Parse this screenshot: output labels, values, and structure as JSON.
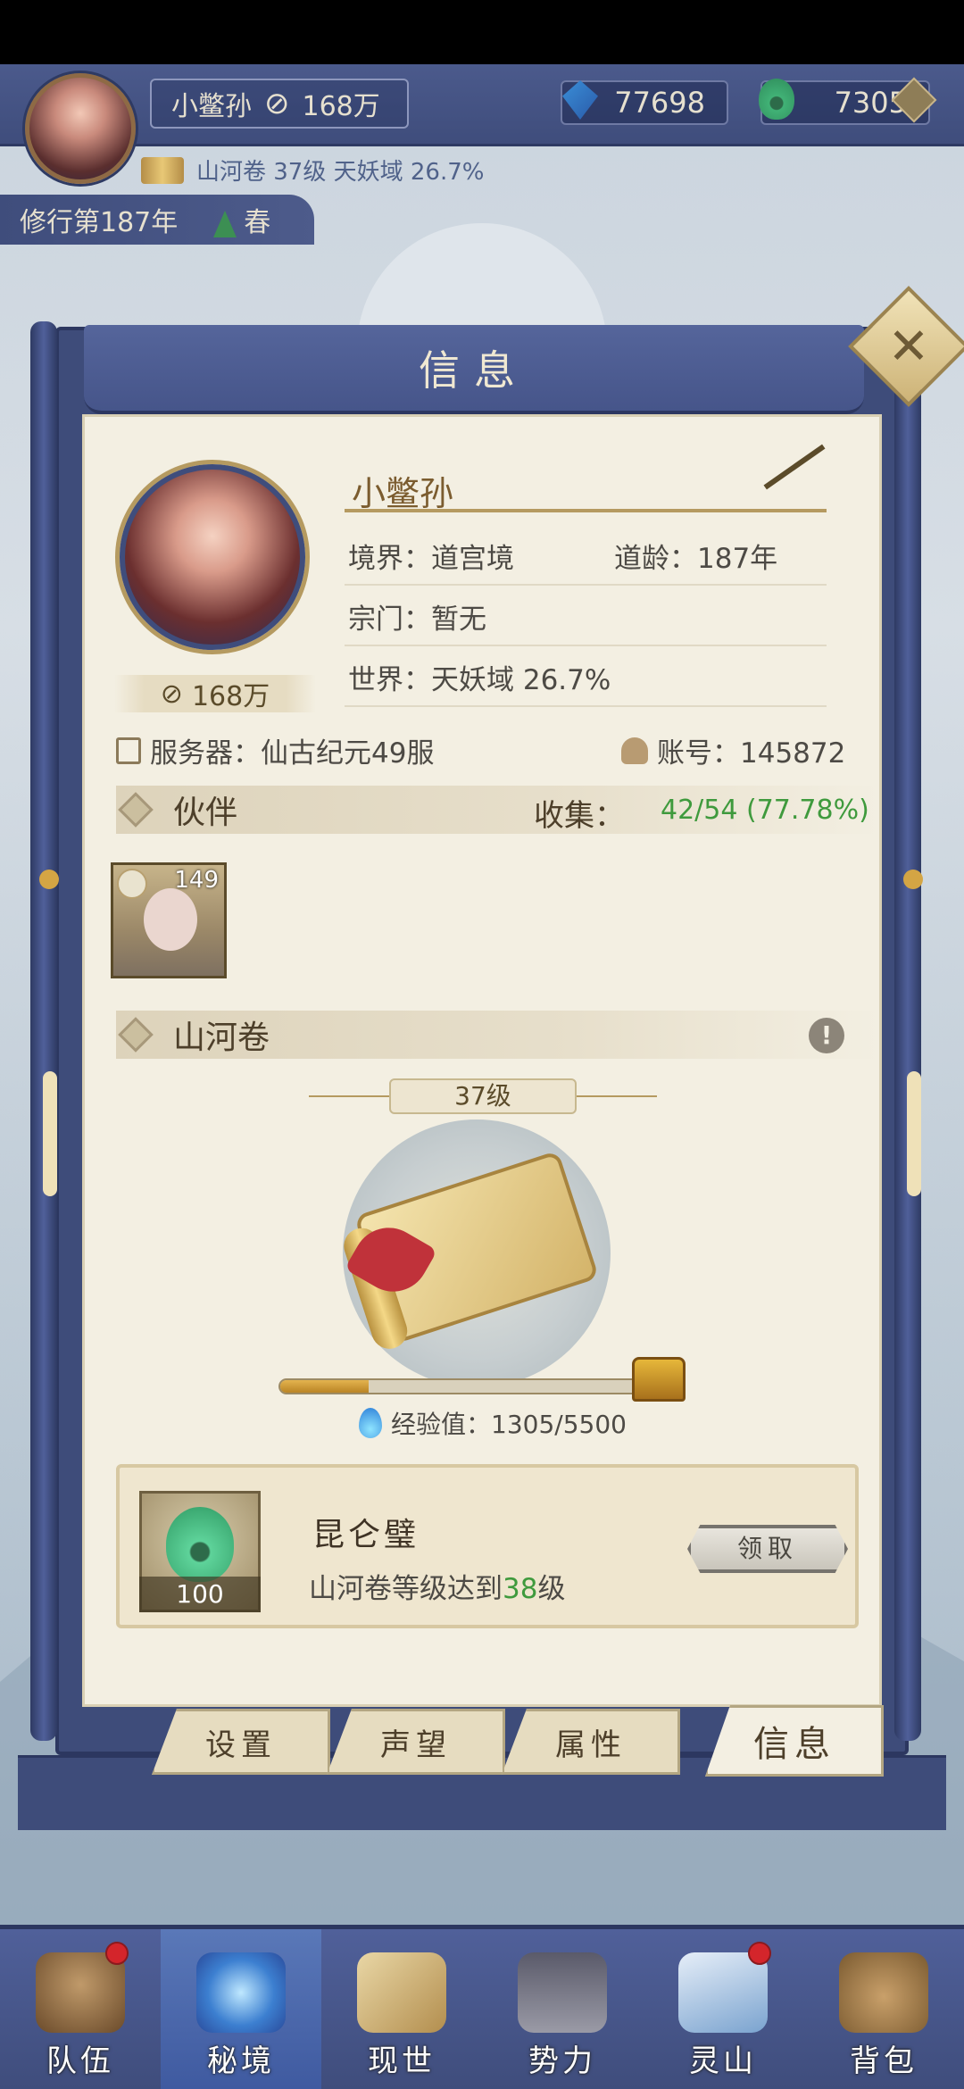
{
  "header": {
    "player_name": "小鳖孙",
    "power": "168万",
    "gems": "77698",
    "jade": "7305",
    "subline": "山河卷 37级 天妖域 26.7%",
    "year": "修行第187年",
    "season": "春"
  },
  "dialog": {
    "title": "信息",
    "close_label": "✕"
  },
  "profile": {
    "name": "小鳖孙",
    "realm_label": "境界：道宫境",
    "age_label": "道龄：187年",
    "sect_label": "宗门：暂无",
    "world_label": "世界：天妖域  26.7%",
    "power": "168万",
    "server_label": "服务器：仙古纪元49服",
    "account_label": "账号：145872"
  },
  "partners": {
    "title": "伙伴",
    "collect_label": "收集：",
    "collect_value": "42/54 (77.78%)",
    "items": [
      {
        "level": "149"
      }
    ]
  },
  "scroll": {
    "title": "山河卷",
    "alert": "!",
    "level": "37级",
    "exp_label": "经验值：1305/5500",
    "exp_current": 1305,
    "exp_max": 5500
  },
  "reward": {
    "name": "昆仑璧",
    "count": "100",
    "desc_prefix": "山河卷等级达到",
    "desc_level": "38",
    "desc_suffix": "级",
    "claim_label": "领取"
  },
  "tabs": [
    {
      "label": "设置",
      "active": false
    },
    {
      "label": "声望",
      "active": false
    },
    {
      "label": "属性",
      "active": false
    },
    {
      "label": "信息",
      "active": true
    }
  ],
  "nav": [
    {
      "label": "队伍",
      "badge": true,
      "active": false
    },
    {
      "label": "秘境",
      "badge": false,
      "active": true
    },
    {
      "label": "现世",
      "badge": false,
      "active": false
    },
    {
      "label": "势力",
      "badge": false,
      "active": false
    },
    {
      "label": "灵山",
      "badge": true,
      "active": false
    },
    {
      "label": "背包",
      "badge": false,
      "active": false
    }
  ],
  "colors": {
    "accent_green": "#3f9a3d",
    "navy": "#3f4d7c",
    "parchment": "#f3efe2"
  }
}
